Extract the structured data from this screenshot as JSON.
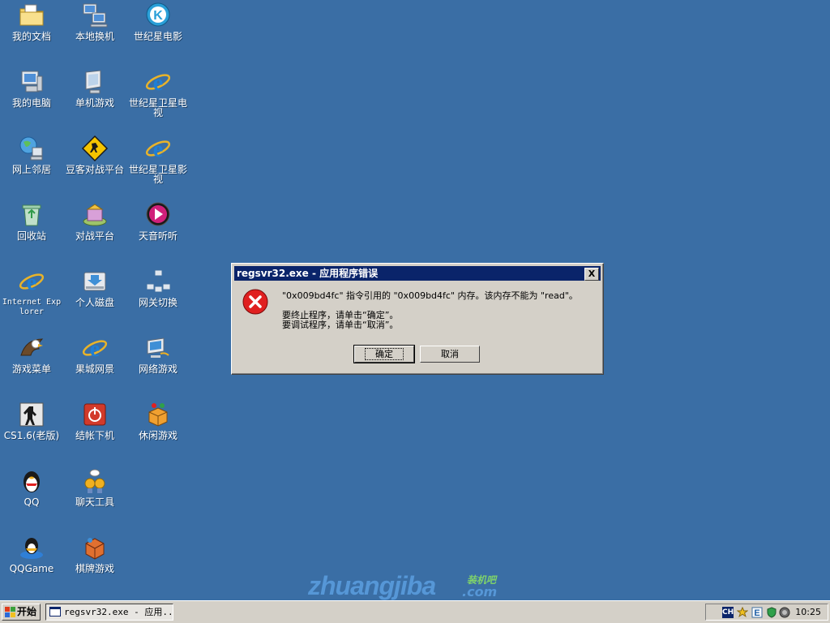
{
  "desktop": {
    "icons": [
      {
        "label": "我的文档"
      },
      {
        "label": "本地换机"
      },
      {
        "label": "世纪星电影"
      },
      {
        "label": "我的电脑"
      },
      {
        "label": "单机游戏"
      },
      {
        "label": "世纪星卫星电视"
      },
      {
        "label": "网上邻居"
      },
      {
        "label": "豆客对战平台"
      },
      {
        "label": "世纪星卫星影视"
      },
      {
        "label": "回收站"
      },
      {
        "label": "对战平台"
      },
      {
        "label": "天音听听"
      },
      {
        "label": "Internet Explorer"
      },
      {
        "label": "个人磁盘"
      },
      {
        "label": "网关切换"
      },
      {
        "label": "游戏菜单"
      },
      {
        "label": "果城网景"
      },
      {
        "label": "网络游戏"
      },
      {
        "label": "CS1.6(老版)"
      },
      {
        "label": "结帐下机"
      },
      {
        "label": "休闲游戏"
      },
      {
        "label": "QQ"
      },
      {
        "label": "聊天工具"
      },
      {
        "label": "QQGame"
      },
      {
        "label": "棋牌游戏"
      }
    ]
  },
  "watermark": {
    "main": "zhuangjiba",
    "cn": "装机吧",
    "com": ".com"
  },
  "dialog": {
    "title": "regsvr32.exe - 应用程序错误",
    "close_label": "X",
    "message_line1": "\"0x009bd4fc\" 指令引用的 \"0x009bd4fc\" 内存。该内存不能为 \"read\"。",
    "message_line2": "要终止程序，请单击“确定”。",
    "message_line3": "要调试程序，请单击“取消”。",
    "ok_label": "确定",
    "cancel_label": "取消",
    "icon": "error-icon"
  },
  "taskbar": {
    "start_label": "开始",
    "task_item_label": "regsvr32.exe - 应用...",
    "tray_ime": "CH",
    "clock": "10:25"
  }
}
